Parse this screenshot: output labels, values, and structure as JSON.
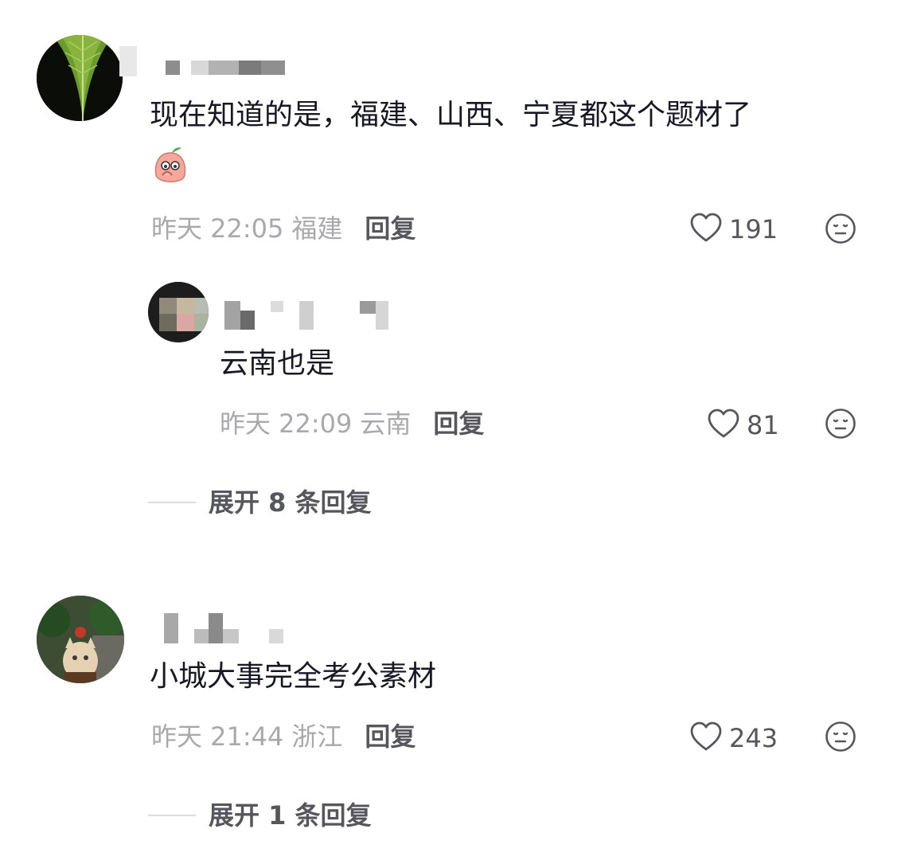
{
  "comments": [
    {
      "text": "现在知道的是，福建、山西、宁夏都这个题材了",
      "emoji": "peach-shy-emoji",
      "time": "昨天 22:05",
      "location": "福建",
      "reply_label": "回复",
      "likes": "191",
      "replies": [
        {
          "text": "云南也是",
          "time": "昨天 22:09",
          "location": "云南",
          "reply_label": "回复",
          "likes": "81"
        }
      ],
      "expand_label": "展开 8 条回复"
    },
    {
      "text": "小城大事完全考公素材",
      "time": "昨天 21:44",
      "location": "浙江",
      "reply_label": "回复",
      "likes": "243",
      "expand_label": "展开 1 条回复"
    }
  ],
  "icons": {
    "like": "heart-outline-icon",
    "dislike": "meh-face-icon"
  },
  "colors": {
    "text_primary": "#161823",
    "text_meta": "#a7a9ad",
    "text_action": "#55575d"
  }
}
